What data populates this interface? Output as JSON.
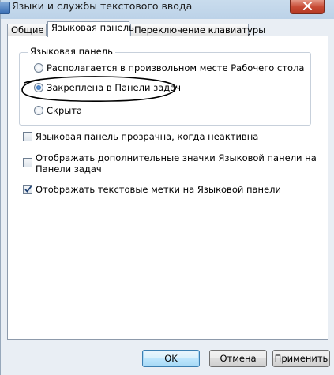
{
  "window": {
    "title": "Языки и службы текстового ввода"
  },
  "tabs": [
    {
      "label": "Общие"
    },
    {
      "label": "Языковая панель"
    },
    {
      "label": "Переключение клавиатуры"
    }
  ],
  "active_tab": "Языковая панель",
  "language_bar_group": {
    "label": "Языковая панель",
    "options": [
      {
        "label": "Располагается в произвольном месте Рабочего стола",
        "selected": false
      },
      {
        "label": "Закреплена в Панели задач",
        "selected": true
      },
      {
        "label": "Скрыта",
        "selected": false
      }
    ]
  },
  "checkboxes": [
    {
      "label": "Языковая панель прозрачна, когда неактивна",
      "checked": false
    },
    {
      "label_line1": "Отображать дополнительные значки Языковой панели на",
      "label_line2": "Панели задач",
      "checked": false
    },
    {
      "label": "Отображать текстовые метки на Языковой панели",
      "checked": true
    }
  ],
  "buttons": {
    "ok": "OK",
    "cancel": "Отмена",
    "apply": "Применить"
  },
  "colors": {
    "titlebar": "#bcd2e8",
    "close_button": "#c74a34",
    "annotation_ellipse": "#000000"
  }
}
